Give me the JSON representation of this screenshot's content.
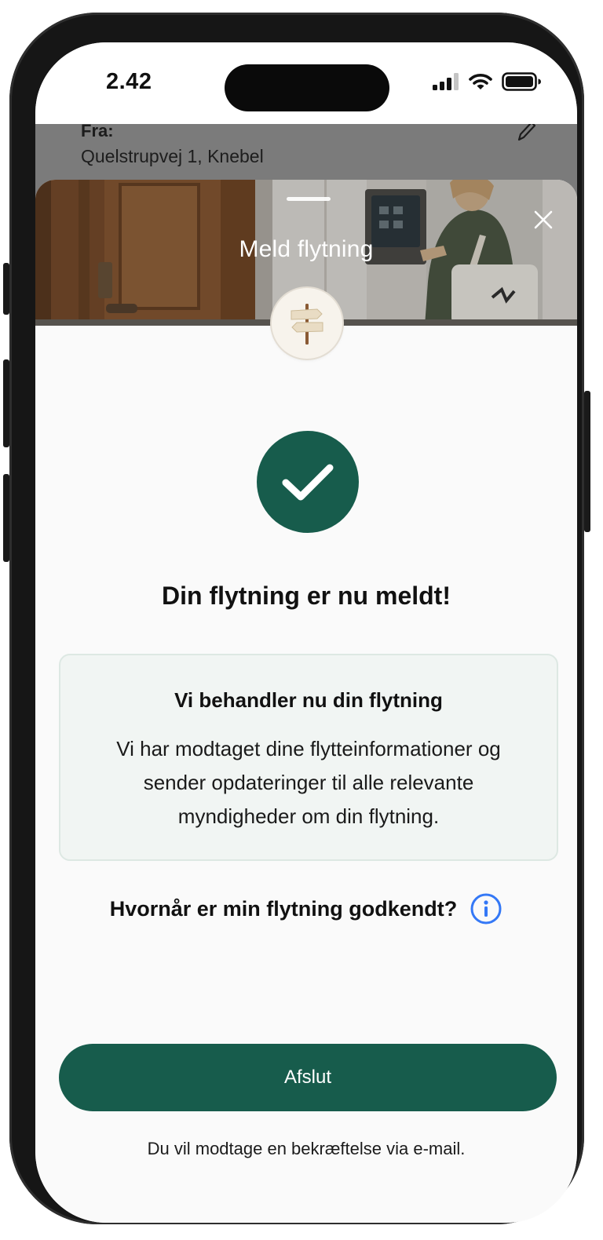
{
  "status_bar": {
    "time": "2.42"
  },
  "underlying_screen": {
    "from_label": "Fra:",
    "address": "Quelstrupvej 1, Knebel"
  },
  "sheet": {
    "title": "Meld flytning",
    "headline": "Din flytning er nu meldt!",
    "info_card": {
      "title": "Vi behandler nu din flytning",
      "body": "Vi har modtaget dine flytteinformationer og sender opdateringer til alle relevante myndigheder om din flytning."
    },
    "question": "Hvornår er min flytning godkendt?",
    "primary_button": "Afslut",
    "footnote": "Du vil modtage en bekræftelse via e-mail."
  },
  "colors": {
    "primary": "#175c4c",
    "info_icon": "#3478f6",
    "card_bg": "#f1f5f3"
  },
  "icons": [
    "signal-icon",
    "wifi-icon",
    "battery-icon",
    "edit-pencil-icon",
    "close-icon",
    "signpost-icon",
    "checkmark-icon",
    "info-icon"
  ]
}
